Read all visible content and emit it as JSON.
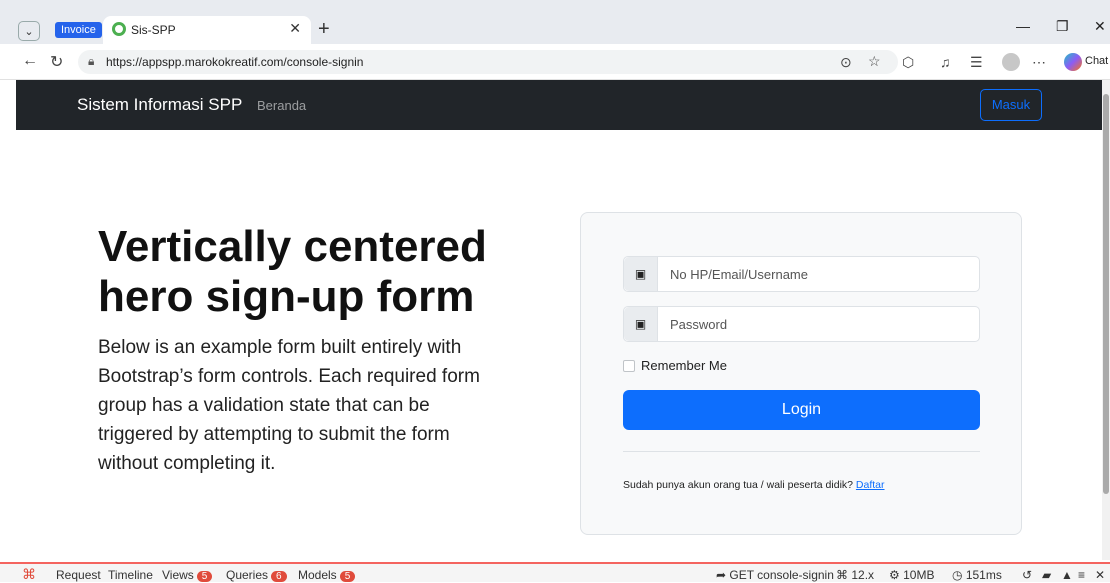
{
  "browser": {
    "tab_group_label": "Invoice",
    "tab_title": "Sis-SPP",
    "url": "https://appspp.marokokreatif.com/console-signin",
    "chat_label": "Chat"
  },
  "navbar": {
    "brand": "Sistem Informasi SPP",
    "links": [
      "Beranda"
    ],
    "login_button": "Masuk"
  },
  "hero": {
    "title": "Vertically centered hero sign-up form",
    "description": "Below is an example form built entirely with Bootstrap’s form controls. Each required form group has a validation state that can be triggered by attempting to submit the form without completing it."
  },
  "form": {
    "username_placeholder": "No HP/Email/Username",
    "password_placeholder": "Password",
    "remember_label": "Remember Me",
    "submit_label": "Login",
    "signup_text": "Sudah punya akun orang tua / wali peserta didik?",
    "signup_link": "Daftar"
  },
  "debugbar": {
    "tabs": [
      {
        "label": "Request",
        "count": ""
      },
      {
        "label": "Timeline",
        "count": ""
      },
      {
        "label": "Views",
        "count": "5"
      },
      {
        "label": "Queries",
        "count": "6"
      },
      {
        "label": "Models",
        "count": "5"
      }
    ],
    "route": "GET console-signin",
    "version": "12.x",
    "memory": "10MB",
    "time": "151ms"
  },
  "colors": {
    "primary": "#0d6efd",
    "navbar_bg": "#212529",
    "debug_accent": "#e04b3b"
  }
}
